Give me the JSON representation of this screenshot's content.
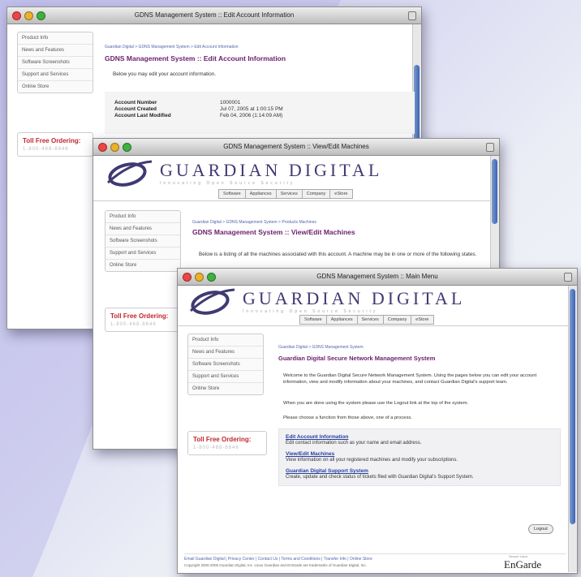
{
  "colors": {
    "accent_title": "#6a1e6e",
    "link": "#263f9c",
    "toll": "#c0272d"
  },
  "win1": {
    "title": "GDNS Management System :: Edit Account Information",
    "sidebar": [
      "Product Info",
      "News and Features",
      "Software Screenshots",
      "Support and Services",
      "Online Store"
    ],
    "toll": {
      "title": "Toll Free Ordering:",
      "number": "1-800-468-8646"
    },
    "breadcrumb": "Guardian Digital > GDNS Management System > Edit Account Information",
    "page_title": "GDNS Management System :: Edit Account Information",
    "intro": "Below you may edit your account information.",
    "account": [
      {
        "label": "Account Number",
        "value": "1000001"
      },
      {
        "label": "Account Created",
        "value": "Jul 07, 2005 at 1:00:15 PM"
      },
      {
        "label": "Account Last Modified",
        "value": "Feb 04, 2006 (1:14:09 AM)"
      }
    ]
  },
  "win2": {
    "title": "GDNS Management System :: View/Edit Machines",
    "logo": "GUARDIAN DIGITAL",
    "logo_sub": "Innovating Open Source Security",
    "tabs": [
      "Software",
      "Appliances",
      "Services",
      "Company",
      "eStore"
    ],
    "sidebar": [
      "Product Info",
      "News and Features",
      "Software Screenshots",
      "Support and Services",
      "Online Store"
    ],
    "toll": {
      "title": "Toll Free Ordering:",
      "number": "1-800-468-8646"
    },
    "breadcrumb": "Guardian Digital > GDNS Management System > Products Machines",
    "page_title": "GDNS Management System :: View/Edit Machines",
    "body": "Below is a listing of all the machines associated with this account. A machine may be in one or more of the following states."
  },
  "win3": {
    "title": "GDNS Management System :: Main Menu",
    "logo": "GUARDIAN DIGITAL",
    "logo_sub": "Innovating Open Source Security",
    "tabs": [
      "Software",
      "Appliances",
      "Services",
      "Company",
      "eStore"
    ],
    "sidebar": [
      "Product Info",
      "News and Features",
      "Software Screenshots",
      "Support and Services",
      "Online Store"
    ],
    "toll": {
      "title": "Toll Free Ordering:",
      "number": "1-800-468-8646"
    },
    "breadcrumb": "Guardian Digital > GDNS Management System",
    "page_title": "Guardian Digital Secure Network Management System",
    "para1": "Welcome to the Guardian Digital Secure Network Management System. Using the pages below you can edit your account information, view and modify information about your machines, and contact Guardian Digital's support team.",
    "para2": "When you are done using the system please use the Logout link at the top of the system.",
    "para3": "Please choose a function from those above, one of a process.",
    "functions": [
      {
        "link": "Edit Account Information",
        "desc": "Edit contact information such as your name and email address."
      },
      {
        "link": "View/Edit Machines",
        "desc": "View information on all your registered machines and modify your subscriptions."
      },
      {
        "link": "Guardian Digital Support System",
        "desc": "Create, update and check status of tickets filed with Guardian Digital's Support System."
      }
    ],
    "logout": "Logout",
    "footer_links": "Email Guardian Digital | Privacy Center | Contact Us | Terms and Conditions | Transfer Info | Online Store",
    "footer_copy": "Copyright 2000-2006 Guardian Digital, Inc. Linux Guardian and EnGarde are trademarks of Guardian Digital, Inc.",
    "brand": "EnGarde",
    "brand_sub": "Secure Linux"
  }
}
